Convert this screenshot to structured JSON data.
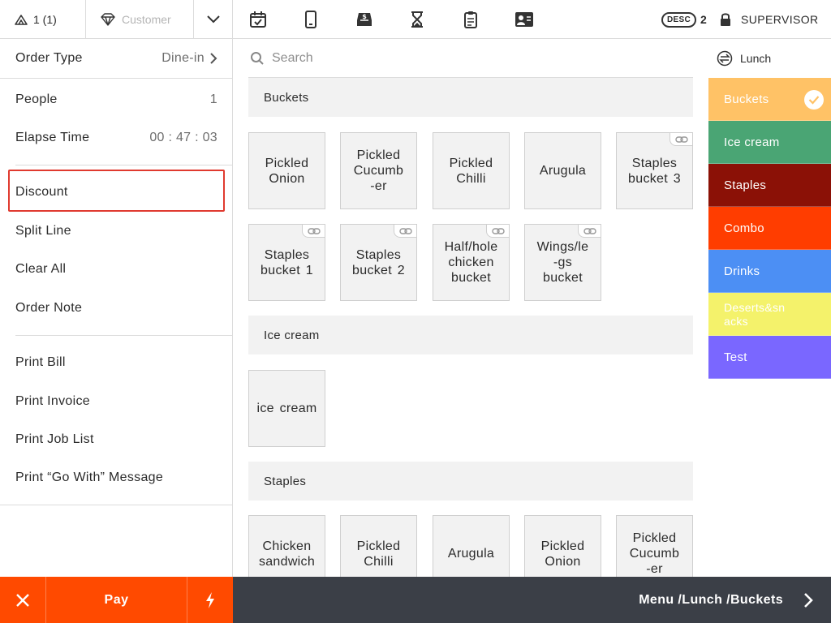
{
  "topbar": {
    "guests": "1 (1)",
    "customer_placeholder": "Customer",
    "desc_badge": "DESC",
    "desc_count": "2",
    "role": "SUPERVISOR",
    "icons": [
      "calendar-check-icon",
      "tablet-icon",
      "cash-drawer-icon",
      "hourglass-icon",
      "clipboard-icon",
      "staff-card-icon"
    ]
  },
  "left": {
    "order_type_label": "Order Type",
    "order_type_value": "Dine-in",
    "people_label": "People",
    "people_value": "1",
    "elapse_label": "Elapse Time",
    "elapse_value": "00 : 47 : 03",
    "actions": [
      "Discount",
      "Split Line",
      "Clear All",
      "Order Note"
    ],
    "prints": [
      "Print Bill",
      "Print Invoice",
      "Print Job List",
      "Print “Go With” Message"
    ]
  },
  "search": {
    "placeholder": "Search"
  },
  "sections": [
    {
      "title": "Buckets",
      "items": [
        {
          "label": "Pickled\nOnion",
          "linked": false
        },
        {
          "label": "Pickled\nCucumb\n-er",
          "linked": false
        },
        {
          "label": "Pickled\nChilli",
          "linked": false
        },
        {
          "label": "Arugula",
          "linked": false
        },
        {
          "label": "Staples\nbucket 3",
          "linked": true
        },
        {
          "label": "Staples\nbucket 1",
          "linked": true
        },
        {
          "label": "Staples\nbucket 2",
          "linked": true
        },
        {
          "label": "Half/hole\nchicken\nbucket",
          "linked": true
        },
        {
          "label": "Wings/le\n-gs\nbucket",
          "linked": true
        }
      ]
    },
    {
      "title": "Ice cream",
      "items": [
        {
          "label": "ice cream",
          "linked": false
        }
      ]
    },
    {
      "title": "Staples",
      "items": [
        {
          "label": "Chicken\nsandwich",
          "linked": false
        },
        {
          "label": "Pickled\nChilli",
          "linked": false
        },
        {
          "label": "Arugula",
          "linked": false
        },
        {
          "label": "Pickled\nOnion",
          "linked": false
        },
        {
          "label": "Pickled\nCucumb\n-er",
          "linked": false
        }
      ]
    }
  ],
  "menu": {
    "name": "Lunch",
    "categories": [
      {
        "label": "Buckets",
        "color": "#ffc266",
        "selected": true
      },
      {
        "label": "Ice cream",
        "color": "#4aa574",
        "selected": false
      },
      {
        "label": "Staples",
        "color": "#8b1106",
        "selected": false
      },
      {
        "label": "Combo",
        "color": "#ff3d00",
        "selected": false
      },
      {
        "label": "Drinks",
        "color": "#4c8ff4",
        "selected": false
      },
      {
        "label": "Deserts&sn\nacks",
        "color": "#f4f26b",
        "selected": false
      },
      {
        "label": "Test",
        "color": "#7a67ff",
        "selected": false
      }
    ]
  },
  "bottom": {
    "pay_label": "Pay",
    "breadcrumb": "Menu /Lunch /Buckets"
  },
  "colors": {
    "accent": "#ff4a00",
    "footer": "#3b3f47",
    "highlight_border": "#e03a2f"
  }
}
